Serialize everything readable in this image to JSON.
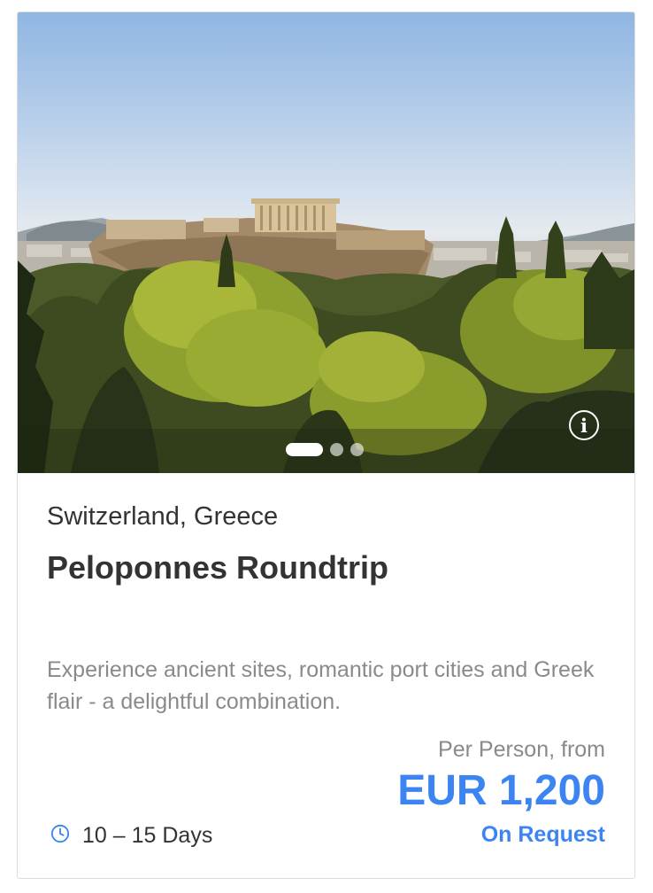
{
  "tour": {
    "image": {
      "description_icon": "info-icon",
      "slide_count": 3,
      "active_slide": 1
    },
    "location": "Switzerland, Greece",
    "title": "Peloponnes Roundtrip",
    "description": "Experience ancient sites, romantic port cities and Greek flair - a delightful combination.",
    "price": {
      "label": "Per Person, from",
      "amount": "EUR 1,200",
      "availability": "On Request"
    },
    "duration": {
      "icon": "clock-icon",
      "label": "10 – 15 Days"
    }
  },
  "colors": {
    "accent": "#3d84f3",
    "text": "#333333",
    "muted": "#8a8a8a",
    "border": "#dcdcdc"
  }
}
